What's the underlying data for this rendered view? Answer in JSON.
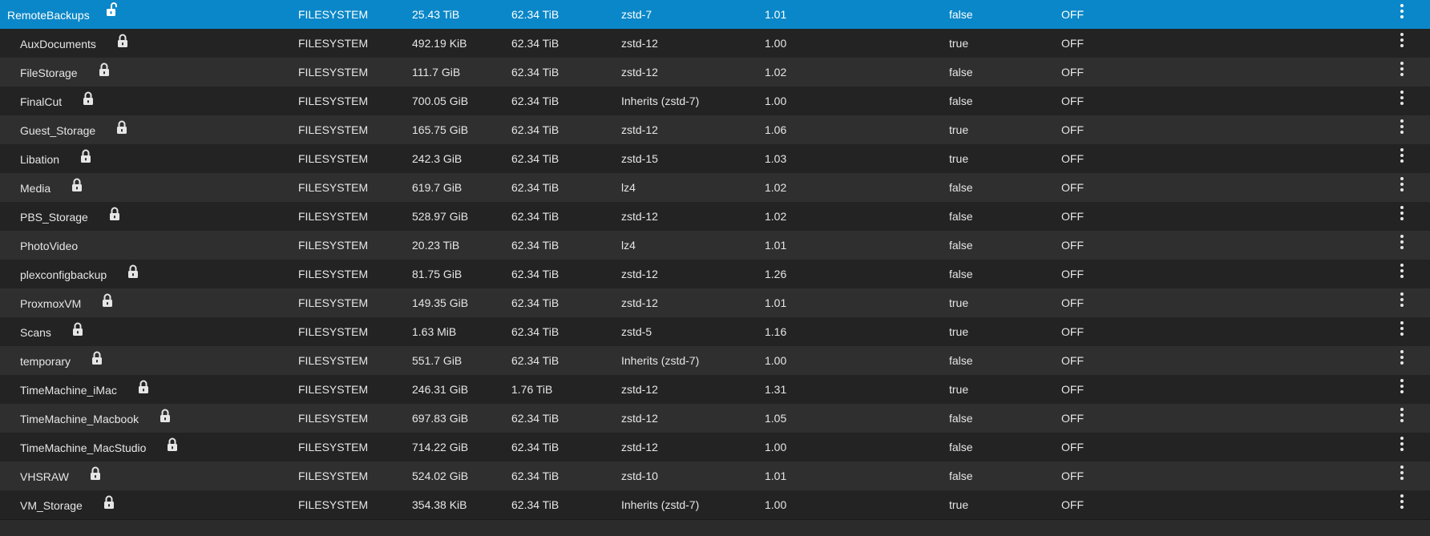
{
  "datasets": [
    {
      "name": "RemoteBackups",
      "locked": false,
      "type": "FILESYSTEM",
      "used": "25.43 TiB",
      "available": "62.34 TiB",
      "compression": "zstd-7",
      "ratio": "1.01",
      "readonly": "false",
      "dedup": "OFF",
      "selected": true
    },
    {
      "name": "AuxDocuments",
      "locked": true,
      "type": "FILESYSTEM",
      "used": "492.19 KiB",
      "available": "62.34 TiB",
      "compression": "zstd-12",
      "ratio": "1.00",
      "readonly": "true",
      "dedup": "OFF"
    },
    {
      "name": "FileStorage",
      "locked": true,
      "type": "FILESYSTEM",
      "used": "111.7 GiB",
      "available": "62.34 TiB",
      "compression": "zstd-12",
      "ratio": "1.02",
      "readonly": "false",
      "dedup": "OFF"
    },
    {
      "name": "FinalCut",
      "locked": true,
      "type": "FILESYSTEM",
      "used": "700.05 GiB",
      "available": "62.34 TiB",
      "compression": "Inherits (zstd-7)",
      "ratio": "1.00",
      "readonly": "false",
      "dedup": "OFF"
    },
    {
      "name": "Guest_Storage",
      "locked": true,
      "type": "FILESYSTEM",
      "used": "165.75 GiB",
      "available": "62.34 TiB",
      "compression": "zstd-12",
      "ratio": "1.06",
      "readonly": "true",
      "dedup": "OFF"
    },
    {
      "name": "Libation",
      "locked": true,
      "type": "FILESYSTEM",
      "used": "242.3 GiB",
      "available": "62.34 TiB",
      "compression": "zstd-15",
      "ratio": "1.03",
      "readonly": "true",
      "dedup": "OFF"
    },
    {
      "name": "Media",
      "locked": true,
      "type": "FILESYSTEM",
      "used": "619.7 GiB",
      "available": "62.34 TiB",
      "compression": "lz4",
      "ratio": "1.02",
      "readonly": "false",
      "dedup": "OFF"
    },
    {
      "name": "PBS_Storage",
      "locked": true,
      "type": "FILESYSTEM",
      "used": "528.97 GiB",
      "available": "62.34 TiB",
      "compression": "zstd-12",
      "ratio": "1.02",
      "readonly": "false",
      "dedup": "OFF"
    },
    {
      "name": "PhotoVideo",
      "locked": null,
      "type": "FILESYSTEM",
      "used": "20.23 TiB",
      "available": "62.34 TiB",
      "compression": "lz4",
      "ratio": "1.01",
      "readonly": "false",
      "dedup": "OFF"
    },
    {
      "name": "plexconfigbackup",
      "locked": true,
      "type": "FILESYSTEM",
      "used": "81.75 GiB",
      "available": "62.34 TiB",
      "compression": "zstd-12",
      "ratio": "1.26",
      "readonly": "false",
      "dedup": "OFF"
    },
    {
      "name": "ProxmoxVM",
      "locked": true,
      "type": "FILESYSTEM",
      "used": "149.35 GiB",
      "available": "62.34 TiB",
      "compression": "zstd-12",
      "ratio": "1.01",
      "readonly": "true",
      "dedup": "OFF"
    },
    {
      "name": "Scans",
      "locked": true,
      "type": "FILESYSTEM",
      "used": "1.63 MiB",
      "available": "62.34 TiB",
      "compression": "zstd-5",
      "ratio": "1.16",
      "readonly": "true",
      "dedup": "OFF"
    },
    {
      "name": "temporary",
      "locked": true,
      "type": "FILESYSTEM",
      "used": "551.7 GiB",
      "available": "62.34 TiB",
      "compression": "Inherits (zstd-7)",
      "ratio": "1.00",
      "readonly": "false",
      "dedup": "OFF"
    },
    {
      "name": "TimeMachine_iMac",
      "locked": true,
      "type": "FILESYSTEM",
      "used": "246.31 GiB",
      "available": "1.76 TiB",
      "compression": "zstd-12",
      "ratio": "1.31",
      "readonly": "true",
      "dedup": "OFF"
    },
    {
      "name": "TimeMachine_Macbook",
      "locked": true,
      "type": "FILESYSTEM",
      "used": "697.83 GiB",
      "available": "62.34 TiB",
      "compression": "zstd-12",
      "ratio": "1.05",
      "readonly": "false",
      "dedup": "OFF"
    },
    {
      "name": "TimeMachine_MacStudio",
      "locked": true,
      "type": "FILESYSTEM",
      "used": "714.22 GiB",
      "available": "62.34 TiB",
      "compression": "zstd-12",
      "ratio": "1.00",
      "readonly": "false",
      "dedup": "OFF"
    },
    {
      "name": "VHSRAW",
      "locked": true,
      "type": "FILESYSTEM",
      "used": "524.02 GiB",
      "available": "62.34 TiB",
      "compression": "zstd-10",
      "ratio": "1.01",
      "readonly": "false",
      "dedup": "OFF"
    },
    {
      "name": "VM_Storage",
      "locked": true,
      "type": "FILESYSTEM",
      "used": "354.38 KiB",
      "available": "62.34 TiB",
      "compression": "Inherits (zstd-7)",
      "ratio": "1.00",
      "readonly": "true",
      "dedup": "OFF"
    }
  ],
  "icons": {
    "locked": "lock-closed-icon",
    "unlocked": "lock-open-icon",
    "actions": "more-vert-icon"
  },
  "colors": {
    "selected_row": "#0a87c8",
    "row_odd": "#2f2f2f",
    "row_even": "#232323",
    "text": "#e6e6e6"
  }
}
